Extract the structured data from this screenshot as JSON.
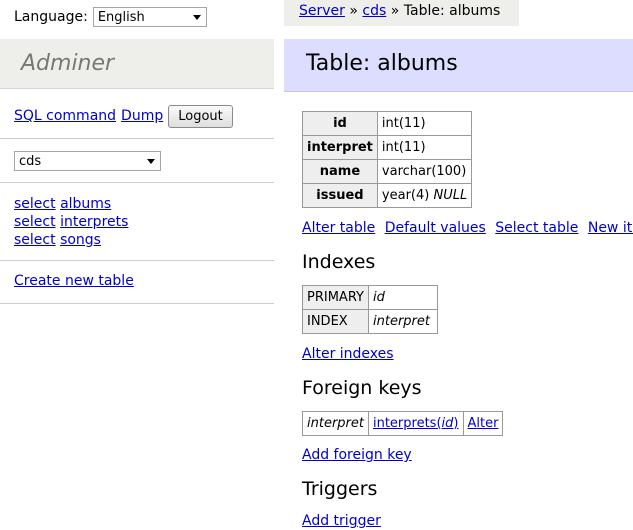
{
  "language": {
    "label": "Language:",
    "selected": "English"
  },
  "brand": "Adminer",
  "side_links": {
    "sql_command": "SQL command",
    "dump": "Dump",
    "logout": "Logout"
  },
  "database_select": "cds",
  "tables": [
    {
      "action": "select",
      "name": "albums"
    },
    {
      "action": "select",
      "name": "interprets"
    },
    {
      "action": "select",
      "name": "songs"
    }
  ],
  "create_table": "Create new table",
  "breadcrumb": {
    "server": "Server",
    "sep": "»",
    "db": "cds",
    "current": "Table: albums"
  },
  "title": "Table: albums",
  "columns": [
    {
      "name": "id",
      "type": "int(11)",
      "extra": ""
    },
    {
      "name": "interpret",
      "type": "int(11)",
      "extra": ""
    },
    {
      "name": "name",
      "type": "varchar(100)",
      "extra": ""
    },
    {
      "name": "issued",
      "type": "year(4)",
      "extra": "NULL"
    }
  ],
  "table_links": {
    "alter": "Alter table",
    "defaults": "Default values",
    "select": "Select table",
    "new_item": "New item"
  },
  "indexes": {
    "heading": "Indexes",
    "rows": [
      {
        "type": "PRIMARY",
        "columns": "id"
      },
      {
        "type": "INDEX",
        "columns": "interpret"
      }
    ],
    "alter_link": "Alter indexes"
  },
  "foreign_keys": {
    "heading": "Foreign keys",
    "row": {
      "source": "interpret",
      "target_table": "interprets",
      "target_column": "id",
      "alter": "Alter"
    },
    "add_link": "Add foreign key"
  },
  "triggers": {
    "heading": "Triggers",
    "add_link": "Add trigger"
  },
  "colors": {
    "link": "#0000cc",
    "title_bg": "#ddddff",
    "side_bg": "#eeeeea"
  }
}
